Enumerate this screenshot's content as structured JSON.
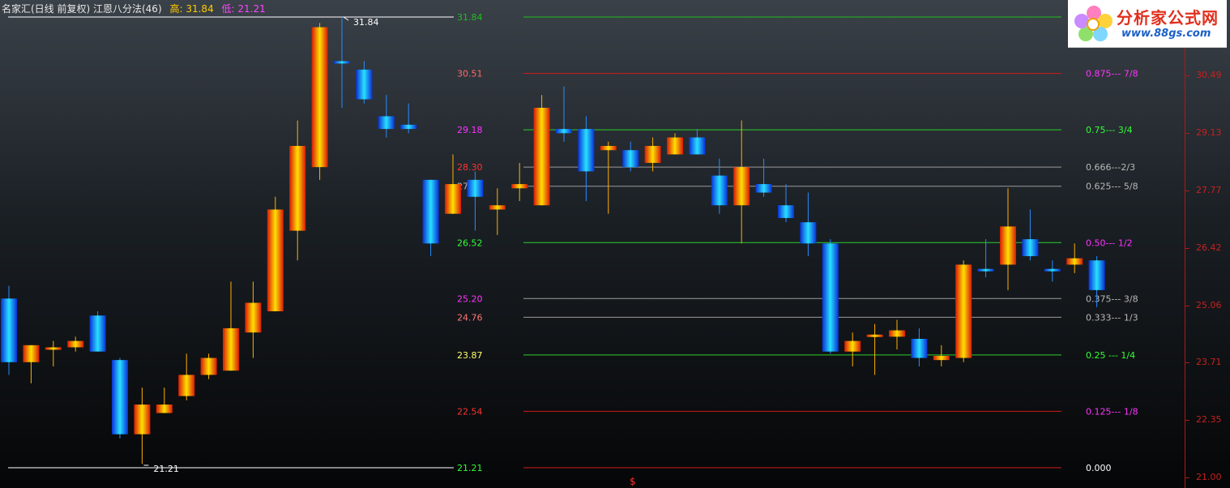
{
  "header": {
    "title": "名家汇(日线 前复权) 江恩八分法(46)",
    "high_label": "高:",
    "high_value": "31.84",
    "low_label": "低:",
    "low_value": "21.21"
  },
  "logo": {
    "text_cn": "分析家公式网",
    "url": "www.88gs.com"
  },
  "marker": "$",
  "chart_data": {
    "type": "candlestick",
    "y_range": [
      21.0,
      31.84
    ],
    "high_annotation": "31.84",
    "low_annotation": "21.21",
    "right_axis_ticks": [
      "30.49",
      "29.13",
      "27.77",
      "26.42",
      "25.06",
      "23.71",
      "22.35",
      "21.00"
    ],
    "right_axis_values": [
      30.49,
      29.13,
      27.77,
      26.42,
      25.06,
      23.71,
      22.35,
      21.0
    ],
    "levels": [
      {
        "price": 31.84,
        "label": "31.84",
        "ratio": "",
        "line_color": "#1fbf1f",
        "label_color": "#1fbf1f",
        "ratio_color": "#1fbf1f"
      },
      {
        "price": 30.51,
        "label": "30.51",
        "ratio": "0.875--- 7/8",
        "line_color": "#d01a1a",
        "label_color": "#ff6a6a",
        "ratio_color": "#ff33ff"
      },
      {
        "price": 29.18,
        "label": "29.18",
        "ratio": "0.75--- 3/4",
        "line_color": "#2ad02a",
        "label_color": "#ff33ff",
        "ratio_color": "#33ff33"
      },
      {
        "price": 28.3,
        "label": "28.30",
        "ratio": "0.666---2/3",
        "line_color": "#9a9a9a",
        "label_color": "#ff3333",
        "ratio_color": "#b8b8b8"
      },
      {
        "price": 27.85,
        "label": "27.85",
        "ratio": "0.625--- 5/8",
        "line_color": "#9a9a9a",
        "label_color": "#b8b8b8",
        "ratio_color": "#b8b8b8"
      },
      {
        "price": 26.52,
        "label": "26.52",
        "ratio": "0.50--- 1/2",
        "line_color": "#2ad02a",
        "label_color": "#33ff33",
        "ratio_color": "#ff33ff"
      },
      {
        "price": 25.2,
        "label": "25.20",
        "ratio": "0.375--- 3/8",
        "line_color": "#9a9a9a",
        "label_color": "#ff33ff",
        "ratio_color": "#b8b8b8"
      },
      {
        "price": 24.76,
        "label": "24.76",
        "ratio": "0.333--- 1/3",
        "line_color": "#9a9a9a",
        "label_color": "#ff7777",
        "ratio_color": "#b8b8b8"
      },
      {
        "price": 23.87,
        "label": "23.87",
        "ratio": "0.25 --- 1/4",
        "line_color": "#2ad02a",
        "label_color": "#ffff66",
        "ratio_color": "#33ff33"
      },
      {
        "price": 22.54,
        "label": "22.54",
        "ratio": "0.125--- 1/8",
        "line_color": "#d01a1a",
        "label_color": "#ff3333",
        "ratio_color": "#ff33ff"
      },
      {
        "price": 21.21,
        "label": "21.21",
        "ratio": "0.000",
        "line_color": "#d01a1a",
        "label_color": "#33ff33",
        "ratio_color": "#ffffff"
      }
    ],
    "candles": [
      {
        "o": 25.2,
        "h": 25.5,
        "l": 23.4,
        "c": 23.7
      },
      {
        "o": 23.7,
        "h": 23.9,
        "l": 23.2,
        "c": 24.1
      },
      {
        "o": 24.0,
        "h": 24.2,
        "l": 23.6,
        "c": 24.05
      },
      {
        "o": 24.05,
        "h": 24.3,
        "l": 23.95,
        "c": 24.2
      },
      {
        "o": 24.8,
        "h": 24.9,
        "l": 24.0,
        "c": 23.95
      },
      {
        "o": 23.75,
        "h": 23.8,
        "l": 21.9,
        "c": 22.0
      },
      {
        "o": 22.0,
        "h": 23.1,
        "l": 21.3,
        "c": 22.7
      },
      {
        "o": 22.5,
        "h": 23.1,
        "l": 22.5,
        "c": 22.7
      },
      {
        "o": 22.9,
        "h": 23.9,
        "l": 22.8,
        "c": 23.4
      },
      {
        "o": 23.4,
        "h": 23.9,
        "l": 23.3,
        "c": 23.8
      },
      {
        "o": 23.5,
        "h": 25.6,
        "l": 23.5,
        "c": 24.5
      },
      {
        "o": 24.4,
        "h": 25.6,
        "l": 23.8,
        "c": 25.1
      },
      {
        "o": 24.9,
        "h": 27.6,
        "l": 24.9,
        "c": 27.3
      },
      {
        "o": 26.8,
        "h": 29.4,
        "l": 26.1,
        "c": 28.8
      },
      {
        "o": 28.3,
        "h": 31.7,
        "l": 28.0,
        "c": 31.6
      },
      {
        "o": 30.8,
        "h": 31.84,
        "l": 29.7,
        "c": 30.75
      },
      {
        "o": 30.6,
        "h": 30.8,
        "l": 29.8,
        "c": 29.9
      },
      {
        "o": 29.5,
        "h": 30.0,
        "l": 29.0,
        "c": 29.2
      },
      {
        "o": 29.3,
        "h": 29.8,
        "l": 29.1,
        "c": 29.2
      },
      {
        "o": 28.0,
        "h": 28.0,
        "l": 26.2,
        "c": 26.5
      },
      {
        "o": 27.2,
        "h": 28.6,
        "l": 27.2,
        "c": 27.9
      },
      {
        "o": 28.0,
        "h": 28.2,
        "l": 26.8,
        "c": 27.6
      },
      {
        "o": 27.3,
        "h": 27.8,
        "l": 26.7,
        "c": 27.4
      },
      {
        "o": 27.8,
        "h": 28.4,
        "l": 27.5,
        "c": 27.9
      },
      {
        "o": 27.4,
        "h": 30.0,
        "l": 27.4,
        "c": 29.7
      },
      {
        "o": 29.2,
        "h": 30.2,
        "l": 28.9,
        "c": 29.1
      },
      {
        "o": 29.2,
        "h": 29.5,
        "l": 27.5,
        "c": 28.2
      },
      {
        "o": 28.7,
        "h": 28.9,
        "l": 27.2,
        "c": 28.8
      },
      {
        "o": 28.7,
        "h": 28.9,
        "l": 28.2,
        "c": 28.3
      },
      {
        "o": 28.4,
        "h": 29.0,
        "l": 28.2,
        "c": 28.8
      },
      {
        "o": 28.6,
        "h": 29.1,
        "l": 28.6,
        "c": 29.0
      },
      {
        "o": 29.0,
        "h": 29.2,
        "l": 28.6,
        "c": 28.6
      },
      {
        "o": 28.1,
        "h": 28.5,
        "l": 27.2,
        "c": 27.4
      },
      {
        "o": 27.4,
        "h": 29.4,
        "l": 26.5,
        "c": 28.3
      },
      {
        "o": 27.9,
        "h": 28.5,
        "l": 27.6,
        "c": 27.7
      },
      {
        "o": 27.4,
        "h": 27.9,
        "l": 27.0,
        "c": 27.1
      },
      {
        "o": 27.0,
        "h": 27.7,
        "l": 26.2,
        "c": 26.5
      },
      {
        "o": 26.5,
        "h": 26.6,
        "l": 23.9,
        "c": 23.95
      },
      {
        "o": 23.95,
        "h": 24.4,
        "l": 23.6,
        "c": 24.2
      },
      {
        "o": 24.3,
        "h": 24.6,
        "l": 23.4,
        "c": 24.35
      },
      {
        "o": 24.3,
        "h": 24.7,
        "l": 24.0,
        "c": 24.45
      },
      {
        "o": 24.25,
        "h": 24.5,
        "l": 23.6,
        "c": 23.8
      },
      {
        "o": 23.75,
        "h": 24.1,
        "l": 23.6,
        "c": 23.85
      },
      {
        "o": 23.8,
        "h": 26.1,
        "l": 23.7,
        "c": 26.0
      },
      {
        "o": 25.9,
        "h": 26.6,
        "l": 25.7,
        "c": 25.85
      },
      {
        "o": 26.0,
        "h": 27.8,
        "l": 25.4,
        "c": 26.9
      },
      {
        "o": 26.6,
        "h": 27.3,
        "l": 26.1,
        "c": 26.2
      },
      {
        "o": 25.9,
        "h": 26.1,
        "l": 25.6,
        "c": 25.85
      },
      {
        "o": 26.0,
        "h": 26.5,
        "l": 25.8,
        "c": 26.15
      },
      {
        "o": 26.1,
        "h": 26.2,
        "l": 25.0,
        "c": 25.4
      }
    ]
  }
}
